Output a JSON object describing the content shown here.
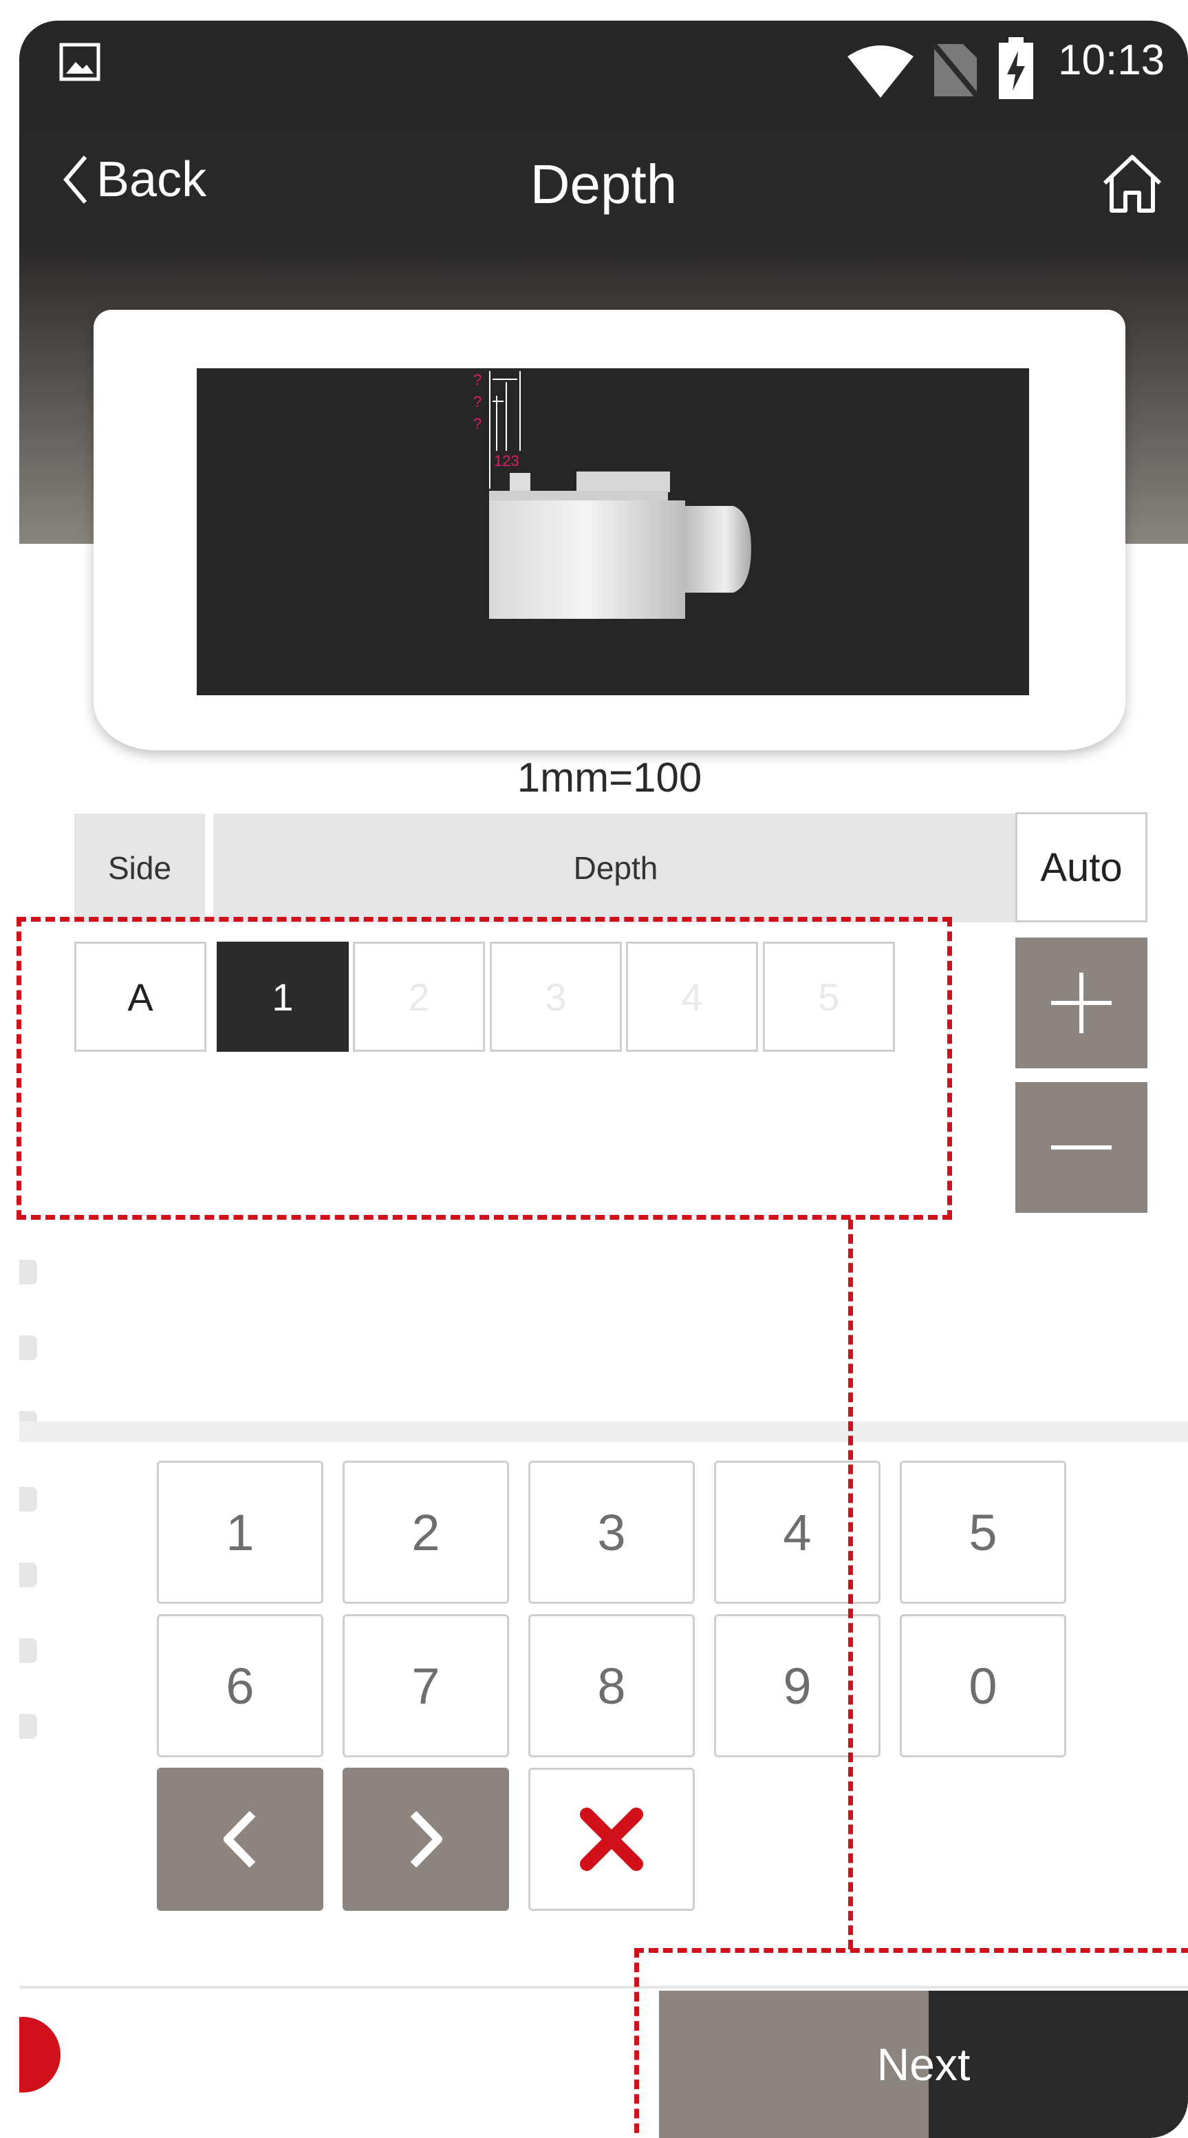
{
  "status_bar": {
    "time": "10:13"
  },
  "nav": {
    "back_label": "Back",
    "title": "Depth"
  },
  "preview": {
    "scale_label": "1mm=100",
    "markers": {
      "q1": "?",
      "q2": "?",
      "q3": "?",
      "index": "123"
    }
  },
  "table": {
    "side_header": "Side",
    "depth_header": "Depth",
    "auto_label": "Auto",
    "side_value": "A",
    "depth_cells": [
      "1",
      "2",
      "3",
      "4",
      "5"
    ],
    "active_index": 0
  },
  "keypad": {
    "row1": [
      "1",
      "2",
      "3",
      "4",
      "5"
    ],
    "row2": [
      "6",
      "7",
      "8",
      "9",
      "0"
    ]
  },
  "footer": {
    "next_label": "Next"
  },
  "colors": {
    "accent_red": "#d0111b",
    "dark": "#2b2a29",
    "taupe": "#8c857f"
  }
}
